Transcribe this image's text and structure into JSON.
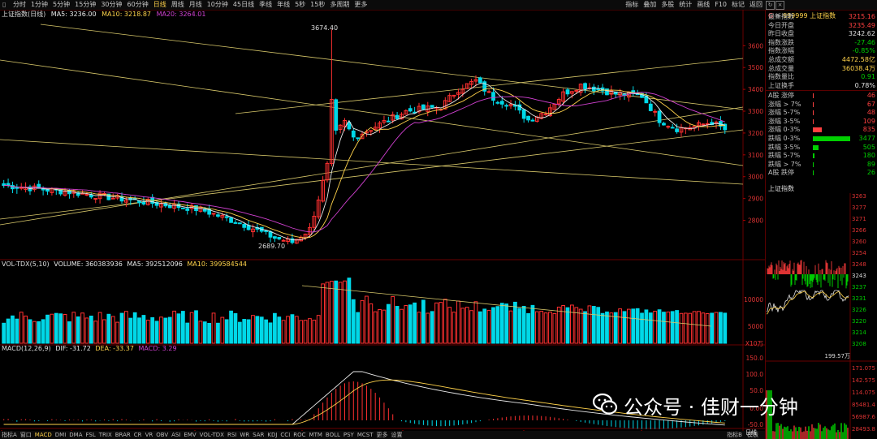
{
  "toolbar": {
    "left_icon": "▯",
    "periods": [
      "分时",
      "1分钟",
      "5分钟",
      "15分钟",
      "30分钟",
      "60分钟",
      "日线",
      "周线",
      "月线",
      "10分钟",
      "45日线",
      "季线",
      "年线",
      "5秒",
      "15秒",
      "多周期",
      "更多"
    ],
    "active_period": "日线",
    "right_tools": [
      "指标",
      "叠加",
      "多股",
      "统计",
      "画线",
      "F10",
      "标记",
      "返回"
    ]
  },
  "chart_header": {
    "name": "上证指数(日线)",
    "ma5": "MA5: 3236.00",
    "ma10": "MA10: 3218.87",
    "ma20": "MA20: 3264.01"
  },
  "price_axis": [
    "3600",
    "3500",
    "3400",
    "3300",
    "3200",
    "3100",
    "3000",
    "2900",
    "2800"
  ],
  "annotations": {
    "high": "3674.40",
    "low": "2689.70"
  },
  "vol_header": {
    "name": "VOL-TDX(5,10)",
    "volume": "VOLUME: 360383936",
    "ma5": "MA5: 392512096",
    "ma10": "MA10: 399584544"
  },
  "vol_axis": [
    "10000",
    "5000",
    "X10万"
  ],
  "macd_header": {
    "name": "MACD(12,26,9)",
    "dif": "DIF: -31.72",
    "dea": "DEA: -33.37",
    "macd": "MACD: 3.29"
  },
  "macd_axis": [
    "150.0",
    "100.0",
    "50.0",
    "0.00",
    "-50.0"
  ],
  "date_axis": [
    "2024年",
    "8",
    "9",
    "10",
    "11",
    "12",
    "1"
  ],
  "bottom_tabs": [
    "指标A",
    "窗口",
    "MACD",
    "DMI",
    "DMA",
    "FSL",
    "TRIX",
    "BRAR",
    "CR",
    "VR",
    "OBV",
    "ASI",
    "EMV",
    "VOL-TDX",
    "RSI",
    "WR",
    "SAR",
    "KDJ",
    "CCI",
    "ROC",
    "MTM",
    "BOLL",
    "PSY",
    "MCST",
    "更多",
    "设置"
  ],
  "bottom_right": [
    "指标B",
    "模板"
  ],
  "side_label": "日线",
  "quote": {
    "code": "999999",
    "name": "上证指数",
    "stats": [
      {
        "label": "最新指数",
        "value": "3215.16",
        "color": "#ff4040"
      },
      {
        "label": "今日开盘",
        "value": "3235.49",
        "color": "#ff4040"
      },
      {
        "label": "昨日收盘",
        "value": "3242.62",
        "color": "#e0e0e0"
      },
      {
        "label": "指数涨跌",
        "value": "-27.46",
        "color": "#00d000"
      },
      {
        "label": "指数涨幅",
        "value": "-0.85%",
        "color": "#00d000"
      },
      {
        "label": "总成交额",
        "value": "4472.58亿",
        "color": "#ffd24a"
      },
      {
        "label": "总成交量",
        "value": "36038.4万",
        "color": "#ffd24a"
      },
      {
        "label": "指数量比",
        "value": "0.91",
        "color": "#00d000"
      },
      {
        "label": "上证换手",
        "value": "0.78%",
        "color": "#e0e0e0"
      }
    ],
    "breadth": [
      {
        "label": "A股 涨停",
        "value": "46",
        "color": "#ff4040",
        "pct": 0.013
      },
      {
        "label": "涨幅 > 7%",
        "value": "67",
        "color": "#ff4040",
        "pct": 0.019
      },
      {
        "label": "涨幅 5-7%",
        "value": "48",
        "color": "#ff4040",
        "pct": 0.014
      },
      {
        "label": "涨幅 3-5%",
        "value": "109",
        "color": "#ff4040",
        "pct": 0.031
      },
      {
        "label": "涨幅 0-3%",
        "value": "835",
        "color": "#ff4040",
        "pct": 0.24
      },
      {
        "label": "跌幅 0-3%",
        "value": "3477",
        "color": "#00d000",
        "pct": 1.0
      },
      {
        "label": "跌幅 3-5%",
        "value": "505",
        "color": "#00d000",
        "pct": 0.145
      },
      {
        "label": "跌幅 5-7%",
        "value": "180",
        "color": "#00d000",
        "pct": 0.052
      },
      {
        "label": "跌幅 > 7%",
        "value": "89",
        "color": "#00d000",
        "pct": 0.026
      },
      {
        "label": "A股 跌停",
        "value": "26",
        "color": "#00d000",
        "pct": 0.008
      }
    ],
    "intraday_title": "上证指数",
    "intraday_axis_right": [
      "3263",
      "3277",
      "3271",
      "3266",
      "3260",
      "3254",
      "3248",
      "3243",
      "3237",
      "3231",
      "3226",
      "3220",
      "3214",
      "3208"
    ],
    "intraday_axis_left_bottom": "199.57万",
    "intraday_vol_axis": [
      "171.075",
      "142.575",
      "114.075",
      "85481.4",
      "56987.6",
      "28493.8"
    ]
  },
  "watermark": {
    "text": "公众号 · 佳财一分钟"
  },
  "colors": {
    "up": "#ff3030",
    "down": "#00d8e8",
    "ma5": "#e8e8e8",
    "ma10": "#ffd24a",
    "ma20": "#d040d0",
    "trend": "#d8c86a"
  }
}
